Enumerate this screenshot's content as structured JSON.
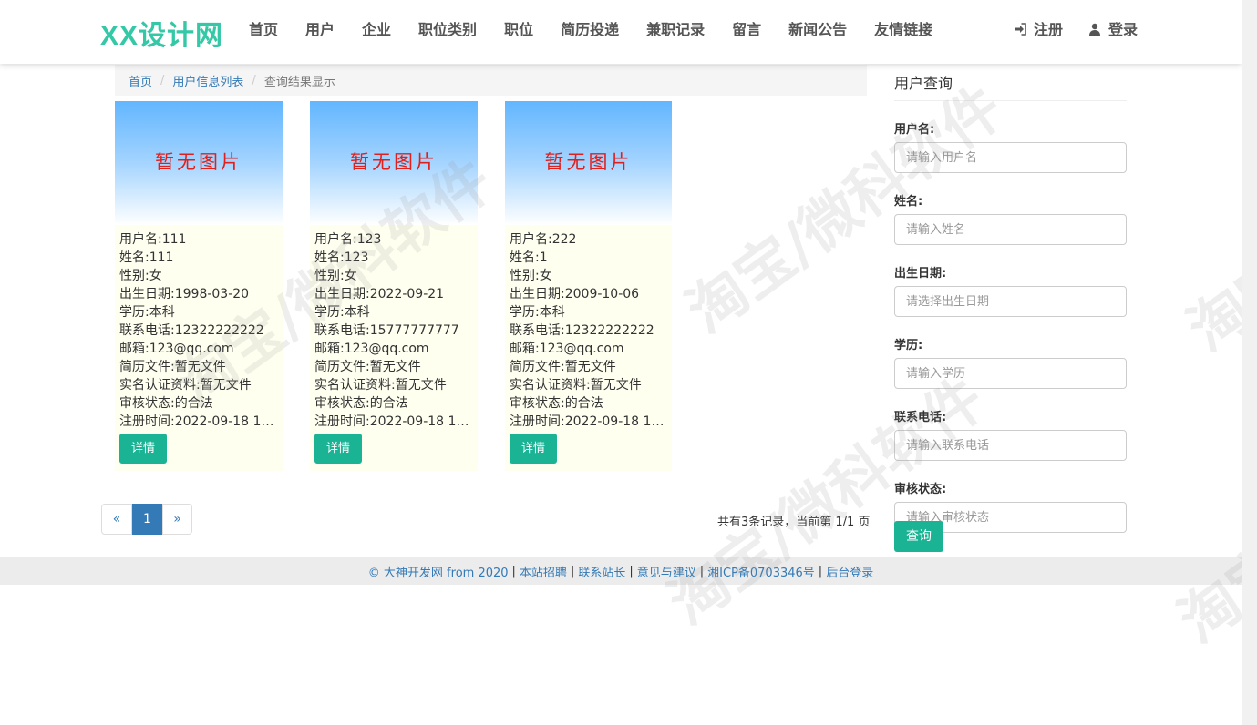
{
  "brand": "XX设计网",
  "nav": {
    "items": [
      "首页",
      "用户",
      "企业",
      "职位类别",
      "职位",
      "简历投递",
      "兼职记录",
      "留言",
      "新闻公告",
      "友情链接"
    ],
    "register": "注册",
    "login": "登录"
  },
  "breadcrumb": {
    "home": "首页",
    "list": "用户信息列表",
    "current": "查询结果显示",
    "separator": "/"
  },
  "cards": [
    {
      "image_placeholder": "暂无图片",
      "lines": [
        "用户名:111",
        "姓名:111",
        "性别:女",
        "出生日期:1998-03-20",
        "学历:本科",
        "联系电话:12322222222",
        "邮箱:123@qq.com",
        "简历文件:暂无文件",
        "实名认证资料:暂无文件",
        "审核状态:的合法",
        "注册时间:2022-09-18 18:..."
      ],
      "button": "详情"
    },
    {
      "image_placeholder": "暂无图片",
      "lines": [
        "用户名:123",
        "姓名:123",
        "性别:女",
        "出生日期:2022-09-21",
        "学历:本科",
        "联系电话:15777777777",
        "邮箱:123@qq.com",
        "简历文件:暂无文件",
        "实名认证资料:暂无文件",
        "审核状态:的合法",
        "注册时间:2022-09-18 18:..."
      ],
      "button": "详情"
    },
    {
      "image_placeholder": "暂无图片",
      "lines": [
        "用户名:222",
        "姓名:1",
        "性别:女",
        "出生日期:2009-10-06",
        "学历:本科",
        "联系电话:12322222222",
        "邮箱:123@qq.com",
        "简历文件:暂无文件",
        "实名认证资料:暂无文件",
        "审核状态:的合法",
        "注册时间:2022-09-18 18:..."
      ],
      "button": "详情"
    }
  ],
  "pagination": {
    "prev": "«",
    "current": "1",
    "next": "»",
    "summary": "共有3条记录，当前第 1/1 页"
  },
  "search": {
    "title": "用户查询",
    "fields": [
      {
        "label": "用户名:",
        "placeholder": "请输入用户名"
      },
      {
        "label": "姓名:",
        "placeholder": "请输入姓名"
      },
      {
        "label": "出生日期:",
        "placeholder": "请选择出生日期"
      },
      {
        "label": "学历:",
        "placeholder": "请输入学历"
      },
      {
        "label": "联系电话:",
        "placeholder": "请输入联系电话"
      },
      {
        "label": "审核状态:",
        "placeholder": "请输入审核状态"
      }
    ],
    "button": "查询"
  },
  "footer": {
    "copyright": "© 大神开发网 from 2020",
    "links": [
      "本站招聘",
      "联系站长",
      "意见与建议",
      "湘ICP备0703346号",
      "后台登录"
    ],
    "separator": "|"
  },
  "watermark": "淘宝/微科软件",
  "colors": {
    "brand": "#35c8a6",
    "button": "#1ab394",
    "link": "#337ab7",
    "placeholder_text": "#e0201d",
    "card_bg": "#fffff0"
  },
  "icons": {
    "register": "sign-in-icon",
    "login": "user-icon"
  }
}
